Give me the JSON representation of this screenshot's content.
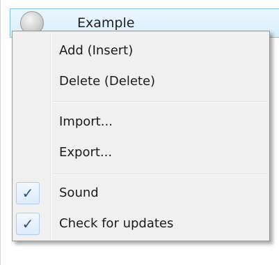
{
  "list": {
    "row_label": "Example"
  },
  "menu": {
    "items": [
      {
        "label": "Add (Insert)"
      },
      {
        "label": "Delete (Delete)"
      },
      {
        "label": "Import..."
      },
      {
        "label": "Export..."
      },
      {
        "label": "Sound",
        "checked": true
      },
      {
        "label": "Check for updates",
        "checked": true
      }
    ],
    "check_glyph": "✓"
  }
}
